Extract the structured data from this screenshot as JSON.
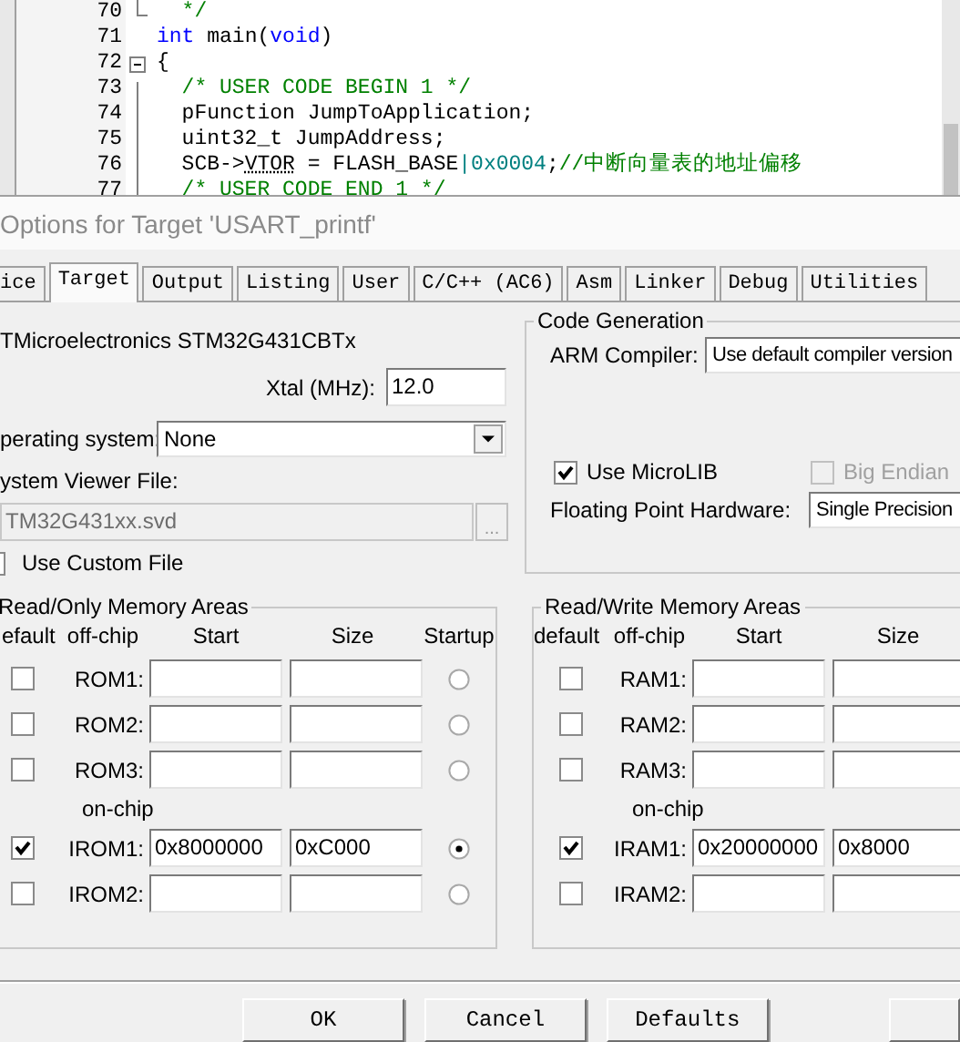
{
  "editor": {
    "lines": [
      {
        "number": "70",
        "kind": "block_end",
        "tokens": [
          {
            "kind": "comment",
            "text": "  */"
          }
        ]
      },
      {
        "number": "71",
        "kind": "plain",
        "tokens": [
          {
            "kind": "keyword",
            "text": "int"
          },
          {
            "kind": "plain",
            "text": " main("
          },
          {
            "kind": "keyword",
            "text": "void"
          },
          {
            "kind": "plain",
            "text": ")"
          }
        ]
      },
      {
        "number": "72",
        "kind": "block_start",
        "tokens": [
          {
            "kind": "plain",
            "text": "{"
          }
        ]
      },
      {
        "number": "73",
        "kind": "in_block",
        "tokens": [
          {
            "kind": "comment",
            "text": "  /* USER CODE BEGIN 1 */"
          }
        ]
      },
      {
        "number": "74",
        "kind": "in_block",
        "tokens": [
          {
            "kind": "plain",
            "text": "  pFunction JumpToApplication;"
          }
        ]
      },
      {
        "number": "75",
        "kind": "in_block",
        "tokens": [
          {
            "kind": "plain",
            "text": "  uint32_t JumpAddress;"
          }
        ]
      },
      {
        "number": "76",
        "kind": "in_block",
        "tokens": [
          {
            "kind": "plain",
            "text": "  SCB->"
          },
          {
            "kind": "member",
            "text": "VTOR"
          },
          {
            "kind": "plain",
            "text": " = FLASH_BASE"
          },
          {
            "kind": "number",
            "text": "|0x0004"
          },
          {
            "kind": "plain",
            "text": ";"
          },
          {
            "kind": "comment",
            "text": "//中断向量表的地址偏移"
          }
        ]
      },
      {
        "number": "77",
        "kind": "in_block",
        "tokens": [
          {
            "kind": "comment",
            "text": "  /* USER CODE END 1 */"
          }
        ]
      }
    ]
  },
  "dialog": {
    "title": "Options for Target 'USART_printf'",
    "tabs": [
      {
        "label": "ice",
        "selected": false
      },
      {
        "label": "Target",
        "selected": true
      },
      {
        "label": "Output",
        "selected": false
      },
      {
        "label": "Listing",
        "selected": false
      },
      {
        "label": "User",
        "selected": false
      },
      {
        "label": "C/C++ (AC6)",
        "selected": false
      },
      {
        "label": "Asm",
        "selected": false
      },
      {
        "label": "Linker",
        "selected": false
      },
      {
        "label": "Debug",
        "selected": false
      },
      {
        "label": "Utilities",
        "selected": false
      }
    ],
    "device": "TMicroelectronics STM32G431CBTx",
    "xtal": {
      "label": "Xtal (MHz):",
      "value": "12.0"
    },
    "operating_system": {
      "label": "perating system:",
      "value": "None"
    },
    "system_viewer_file": {
      "label": "ystem Viewer File:",
      "value": "TM32G431xx.svd",
      "disabled": true,
      "browse": "..."
    },
    "custom_file": {
      "label": "Use Custom File",
      "checked": false
    },
    "code_generation": {
      "title": "Code Generation",
      "arm_compiler": {
        "label": "ARM Compiler:",
        "value": "Use default compiler version"
      },
      "microlib": {
        "label": "Use MicroLIB",
        "checked": true,
        "disabled": false
      },
      "big_endian": {
        "label": "Big Endian",
        "checked": false,
        "disabled": true
      },
      "fpu": {
        "label": "Floating Point Hardware:",
        "value": "Single Precision"
      }
    },
    "rom": {
      "title": "Read/Only Memory Areas",
      "columns": [
        "efault",
        "off-chip",
        "Start",
        "Size",
        "Startup"
      ],
      "rows": [
        {
          "kind": "area",
          "label": "ROM1:",
          "checked": false,
          "selected": false
        },
        {
          "kind": "area",
          "label": "ROM2:",
          "checked": false,
          "selected": false
        },
        {
          "kind": "area",
          "label": "ROM3:",
          "checked": false,
          "selected": false
        },
        {
          "kind": "section",
          "label": "on-chip"
        },
        {
          "kind": "area",
          "label": "IROM1:",
          "checked": true,
          "start": "0x8000000",
          "size": "0xC000",
          "selected": true
        },
        {
          "kind": "area",
          "label": "IROM2:",
          "checked": false,
          "selected": false
        }
      ]
    },
    "ram": {
      "title": "Read/Write Memory Areas",
      "columns": [
        "default",
        "off-chip",
        "Start",
        "Size"
      ],
      "rows": [
        {
          "kind": "area",
          "label": "RAM1:",
          "checked": false
        },
        {
          "kind": "area",
          "label": "RAM2:",
          "checked": false
        },
        {
          "kind": "area",
          "label": "RAM3:",
          "checked": false
        },
        {
          "kind": "section",
          "label": "on-chip"
        },
        {
          "kind": "area",
          "label": "IRAM1:",
          "checked": true,
          "start": "0x20000000",
          "size": "0x8000"
        },
        {
          "kind": "area",
          "label": "IRAM2:",
          "checked": false
        }
      ]
    },
    "buttons": [
      "OK",
      "Cancel",
      "Defaults"
    ]
  }
}
